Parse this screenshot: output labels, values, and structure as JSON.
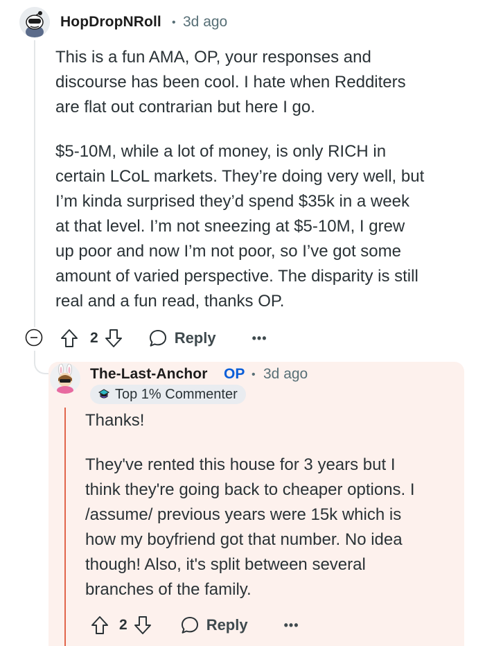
{
  "parent_comment": {
    "author": "HopDropNRoll",
    "separator": "•",
    "timestamp": "3d ago",
    "avatar_icon": "snoo-avatar-icon",
    "paragraphs": [
      "This is a fun AMA, OP, your responses and\ndiscourse has been cool. I hate when Redditers\nare flat out contrarian but here I go.",
      "$5-10M, while a lot of money, is only RICH in\ncertain LCoL markets. They’re doing very well, but\nI’m kinda surprised they’d spend $35k in a week\nat that level. I’m not sneezing at $5-10M, I grew\nup poor and now I’m not poor, so I’ve got some\namount of varied perspective. The disparity is still\nreal and a fun read, thanks OP."
    ],
    "actions": {
      "vote_count": "2",
      "reply_label": "Reply",
      "more_label": "•••"
    }
  },
  "reply_comment": {
    "author": "The-Last-Anchor",
    "op_label": "OP",
    "separator": "•",
    "timestamp": "3d ago",
    "badge_label": "Top 1% Commenter",
    "paragraphs": [
      "Thanks!",
      "They've rented this house for 3 years but I\nthink they're going back to cheaper options. I\n/assume/ previous years were 15k which is\nhow my boyfriend got that number. No idea\nthough! Also, it's split between several\nbranches of the family."
    ],
    "actions": {
      "vote_count": "2",
      "reply_label": "Reply",
      "more_label": "•••"
    }
  },
  "colors": {
    "highlight_background": "#fdf1ed",
    "op_accent": "#0a5ed8",
    "reply_rail": "#e0644a",
    "meta_text": "#576f76"
  }
}
